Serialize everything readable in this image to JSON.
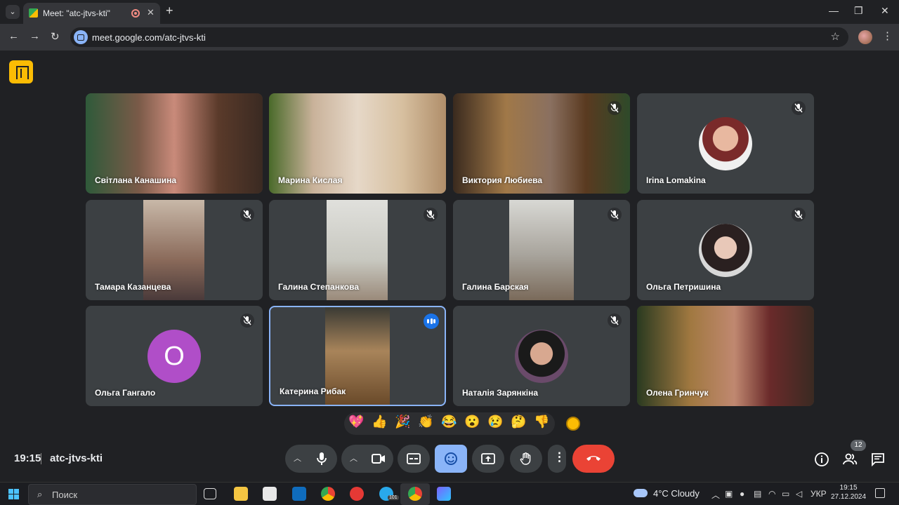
{
  "browser": {
    "tab_title": "Meet: \"atc-jtvs-kti\"",
    "url": "meet.google.com/atc-jtvs-kti",
    "new_tab_symbol": "+",
    "tab_close_symbol": "✕",
    "minimize_symbol": "—",
    "maximize_symbol": "❐",
    "close_symbol": "✕"
  },
  "participants": [
    {
      "name": "Світлана Канашина",
      "muted": false,
      "view": "camera"
    },
    {
      "name": "Марина Кислая",
      "muted": false,
      "view": "camera"
    },
    {
      "name": "Виктория Любиева",
      "muted": true,
      "view": "camera"
    },
    {
      "name": "Irina Lomakina",
      "muted": true,
      "view": "avatar"
    },
    {
      "name": "Тамара Казанцева",
      "muted": true,
      "view": "camera"
    },
    {
      "name": "Галина Степанкова",
      "muted": true,
      "view": "camera"
    },
    {
      "name": "Галина Барская",
      "muted": true,
      "view": "camera"
    },
    {
      "name": "Ольга Петришина",
      "muted": true,
      "view": "avatar"
    },
    {
      "name": "Ольга Гангало",
      "muted": true,
      "view": "letter",
      "letter": "О",
      "letter_color": "#b04ec8"
    },
    {
      "name": "Катерина Рибак",
      "muted": false,
      "view": "camera",
      "speaking": true
    },
    {
      "name": "Наталія Зарянкіна",
      "muted": true,
      "view": "avatar"
    },
    {
      "name": "Олена Гринчук",
      "muted": false,
      "view": "camera"
    }
  ],
  "reactions": [
    "💖",
    "👍",
    "🎉",
    "👏",
    "😂",
    "😮",
    "😢",
    "🤔",
    "👎"
  ],
  "meeting": {
    "time": "19:15",
    "code": "atc-jtvs-kti",
    "participant_count": "12"
  },
  "taskbar": {
    "search_placeholder": "Поиск",
    "weather": "4°C  Cloudy",
    "language": "УКР",
    "time": "19:15",
    "date": "27.12.2024",
    "telegram_badge": "101"
  },
  "colors": {
    "accent": "#8ab4f8",
    "hangup": "#ea4335",
    "background": "#202124",
    "tile": "#3c4043"
  }
}
